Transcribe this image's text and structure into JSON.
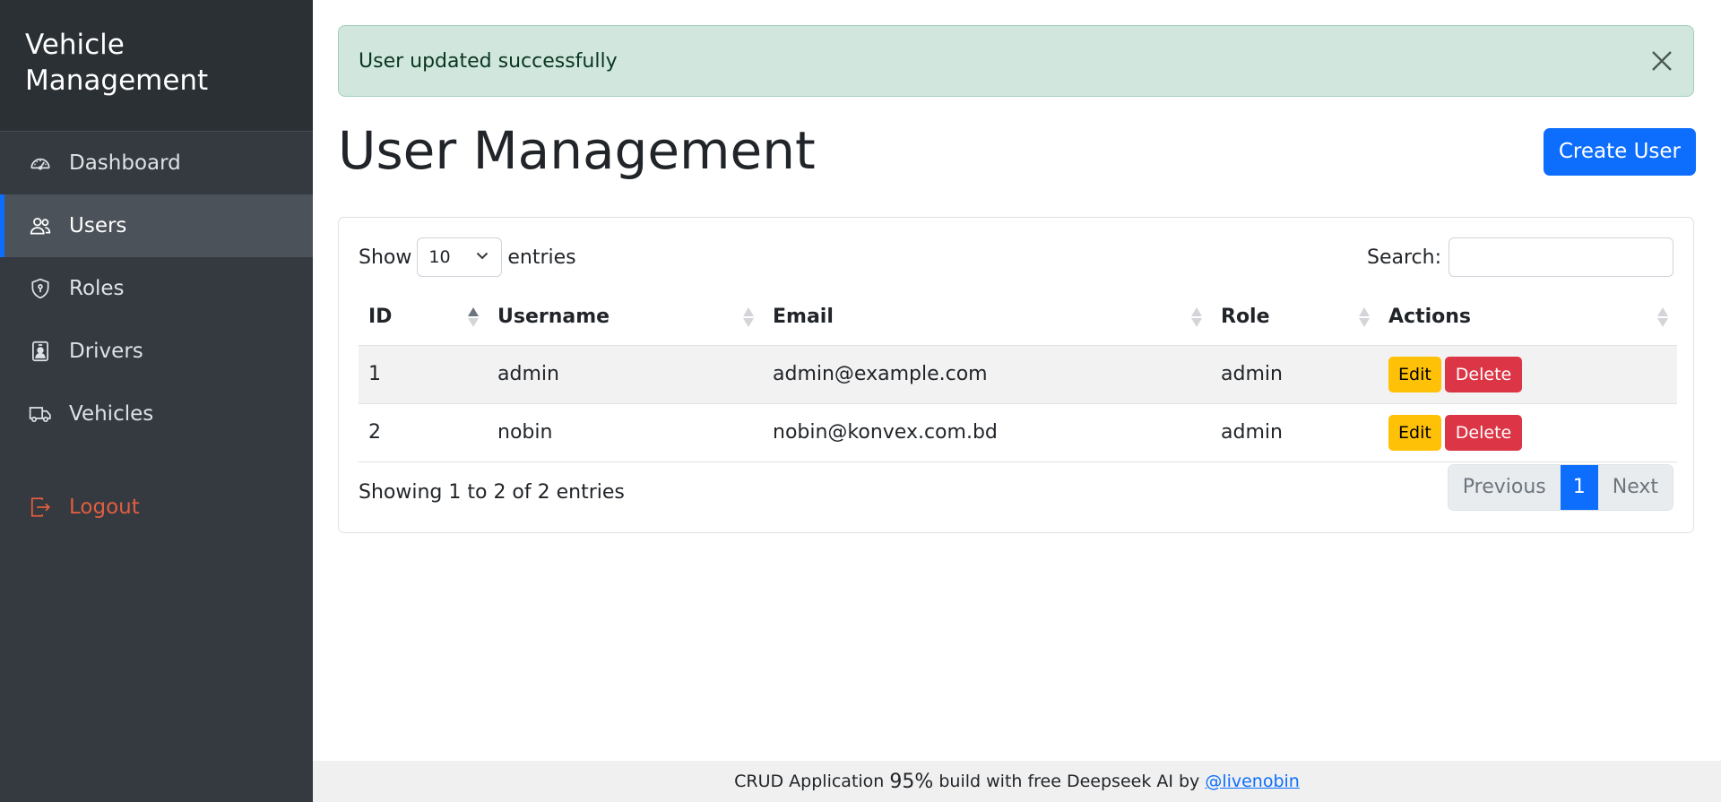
{
  "brand": {
    "title": "Vehicle Management"
  },
  "sidebar": {
    "items": [
      {
        "label": "Dashboard",
        "icon": "speedometer-icon",
        "active": false
      },
      {
        "label": "Users",
        "icon": "users-icon",
        "active": true
      },
      {
        "label": "Roles",
        "icon": "shield-icon",
        "active": false
      },
      {
        "label": "Drivers",
        "icon": "person-badge-icon",
        "active": false
      },
      {
        "label": "Vehicles",
        "icon": "truck-icon",
        "active": false
      }
    ],
    "logout": {
      "label": "Logout",
      "icon": "logout-icon",
      "color": "#e35d3f"
    }
  },
  "alert": {
    "message": "User updated successfully"
  },
  "page": {
    "title": "User Management",
    "create_button": "Create User"
  },
  "table_controls": {
    "show_label": "Show",
    "page_length": "10",
    "entries_label": "entries",
    "search_label": "Search:",
    "search_value": ""
  },
  "table": {
    "columns": [
      "ID",
      "Username",
      "Email",
      "Role",
      "Actions"
    ],
    "rows": [
      {
        "id": "1",
        "username": "admin",
        "email": "admin@example.com",
        "role": "admin",
        "edit": "Edit",
        "delete": "Delete"
      },
      {
        "id": "2",
        "username": "nobin",
        "email": "nobin@konvex.com.bd",
        "role": "admin",
        "edit": "Edit",
        "delete": "Delete"
      }
    ]
  },
  "pagination": {
    "info": "Showing 1 to 2 of 2 entries",
    "previous": "Previous",
    "current": "1",
    "next": "Next"
  },
  "footer": {
    "text_before": "CRUD Application",
    "percent": "95%",
    "text_after": "build with free Deepseek AI by",
    "link": "@livenobin"
  },
  "colors": {
    "sidebar_bg": "#343a40",
    "primary": "#0d6efd",
    "success_bg": "#d1e7dd",
    "warning": "#ffc107",
    "danger": "#dc3545"
  }
}
